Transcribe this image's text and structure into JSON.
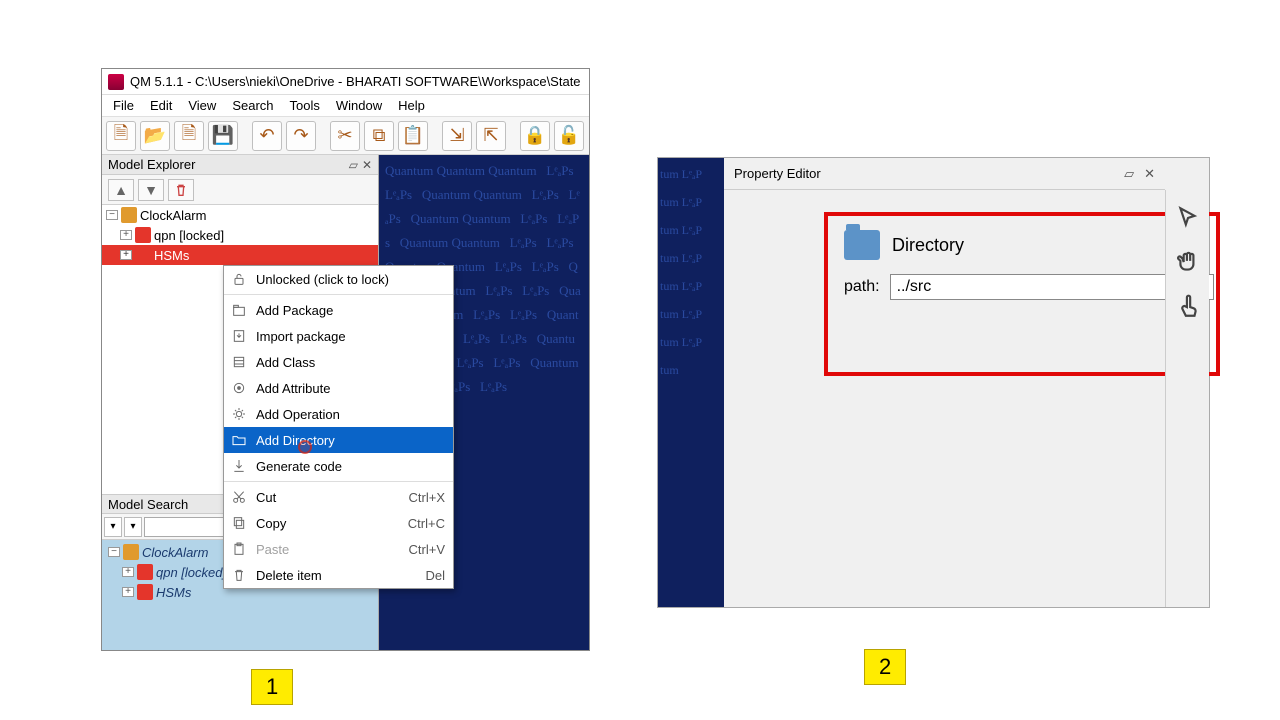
{
  "window": {
    "title": "QM 5.1.1 - C:\\Users\\nieki\\OneDrive - BHARATI SOFTWARE\\Workspace\\State"
  },
  "menus": [
    "File",
    "Edit",
    "View",
    "Search",
    "Tools",
    "Window",
    "Help"
  ],
  "explorer": {
    "title": "Model Explorer",
    "tree": [
      {
        "label": "ClockAlarm",
        "level": 0
      },
      {
        "label": "qpn [locked]",
        "level": 1
      },
      {
        "label": "HSMs",
        "level": 1,
        "selected": true
      }
    ]
  },
  "search": {
    "title": "Model Search",
    "value": "",
    "results": [
      {
        "label": "ClockAlarm",
        "level": 0
      },
      {
        "label": "qpn [locked]",
        "level": 1
      },
      {
        "label": "HSMs",
        "level": 1
      }
    ]
  },
  "context_menu": [
    {
      "label": "Unlocked (click to lock)",
      "icon": "lock"
    },
    {
      "sep": true
    },
    {
      "label": "Add Package",
      "icon": "package"
    },
    {
      "label": "Import package",
      "icon": "import"
    },
    {
      "label": "Add Class",
      "icon": "class"
    },
    {
      "label": "Add Attribute",
      "icon": "attribute"
    },
    {
      "label": "Add Operation",
      "icon": "operation"
    },
    {
      "label": "Add Directory",
      "icon": "folder",
      "highlight": true
    },
    {
      "label": "Generate code",
      "icon": "generate"
    },
    {
      "sep": true
    },
    {
      "label": "Cut",
      "icon": "cut",
      "shortcut": "Ctrl+X"
    },
    {
      "label": "Copy",
      "icon": "copy",
      "shortcut": "Ctrl+C"
    },
    {
      "label": "Paste",
      "icon": "paste",
      "shortcut": "Ctrl+V",
      "disabled": true
    },
    {
      "label": "Delete item",
      "icon": "delete",
      "shortcut": "Del"
    }
  ],
  "property_editor": {
    "title": "Property Editor",
    "kind": "Directory",
    "path_label": "path:",
    "path_value": "../src"
  },
  "callouts": {
    "one": "1",
    "two": "2"
  }
}
